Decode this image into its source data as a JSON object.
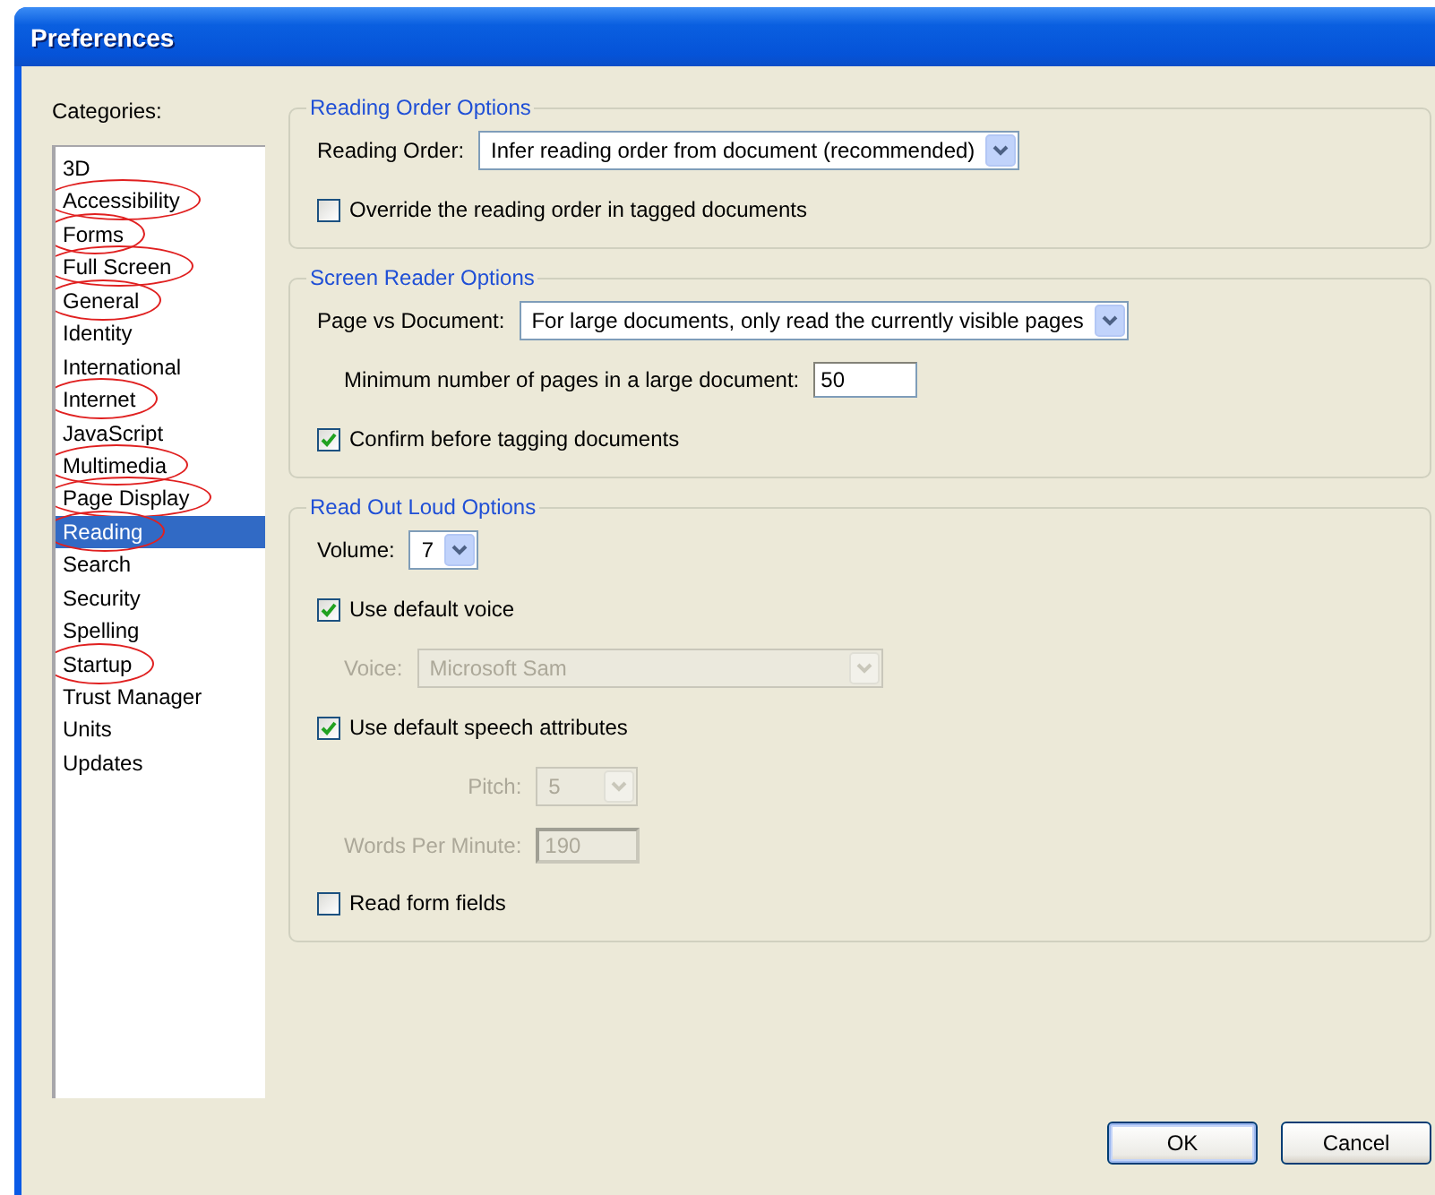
{
  "window": {
    "title": "Preferences"
  },
  "categories": {
    "label": "Categories:",
    "items": [
      {
        "label": "3D",
        "selected": false,
        "circled": false
      },
      {
        "label": "Accessibility",
        "selected": false,
        "circled": true
      },
      {
        "label": "Forms",
        "selected": false,
        "circled": true
      },
      {
        "label": "Full Screen",
        "selected": false,
        "circled": true
      },
      {
        "label": "General",
        "selected": false,
        "circled": true
      },
      {
        "label": "Identity",
        "selected": false,
        "circled": false
      },
      {
        "label": "International",
        "selected": false,
        "circled": false
      },
      {
        "label": "Internet",
        "selected": false,
        "circled": true
      },
      {
        "label": "JavaScript",
        "selected": false,
        "circled": false
      },
      {
        "label": "Multimedia",
        "selected": false,
        "circled": true
      },
      {
        "label": "Page Display",
        "selected": false,
        "circled": true
      },
      {
        "label": "Reading",
        "selected": true,
        "circled": true
      },
      {
        "label": "Search",
        "selected": false,
        "circled": false
      },
      {
        "label": "Security",
        "selected": false,
        "circled": false
      },
      {
        "label": "Spelling",
        "selected": false,
        "circled": false
      },
      {
        "label": "Startup",
        "selected": false,
        "circled": true
      },
      {
        "label": "Trust Manager",
        "selected": false,
        "circled": false
      },
      {
        "label": "Units",
        "selected": false,
        "circled": false
      },
      {
        "label": "Updates",
        "selected": false,
        "circled": false
      }
    ]
  },
  "groups": [
    {
      "title": "Reading Order Options",
      "items": [
        {
          "kind": "dropdown",
          "label": "Reading Order:",
          "value": "Infer reading order from document (recommended)",
          "disabled": false
        },
        {
          "kind": "checkbox",
          "label": "Override the reading order in tagged documents",
          "checked": false
        }
      ]
    },
    {
      "title": "Screen Reader Options",
      "items": [
        {
          "kind": "dropdown",
          "label": "Page vs Document:",
          "value": "For large documents, only read the currently visible pages",
          "disabled": false
        },
        {
          "kind": "field",
          "label": "Minimum number of pages in a large document:",
          "value": "50",
          "disabled": false
        },
        {
          "kind": "checkbox",
          "label": "Confirm before tagging documents",
          "checked": true
        }
      ]
    },
    {
      "title": "Read Out Loud Options",
      "items": [
        {
          "kind": "dropdown",
          "label": "Volume:",
          "value": "7",
          "disabled": false
        },
        {
          "kind": "checkbox",
          "label": "Use default voice",
          "checked": true,
          "children": [
            {
              "kind": "dropdown",
              "label": "Voice:",
              "value": "Microsoft Sam",
              "disabled": true
            }
          ]
        },
        {
          "kind": "checkbox",
          "label": "Use default speech attributes",
          "checked": true,
          "children": [
            {
              "kind": "dropdown",
              "label": "Pitch:",
              "value": "5",
              "disabled": true
            },
            {
              "kind": "field",
              "label": "Words Per Minute:",
              "value": "190",
              "disabled": true
            }
          ]
        },
        {
          "kind": "checkbox",
          "label": "Read form fields",
          "checked": false
        }
      ]
    }
  ],
  "buttons": [
    {
      "label": "OK",
      "default": true
    },
    {
      "label": "Cancel",
      "default": false
    }
  ]
}
